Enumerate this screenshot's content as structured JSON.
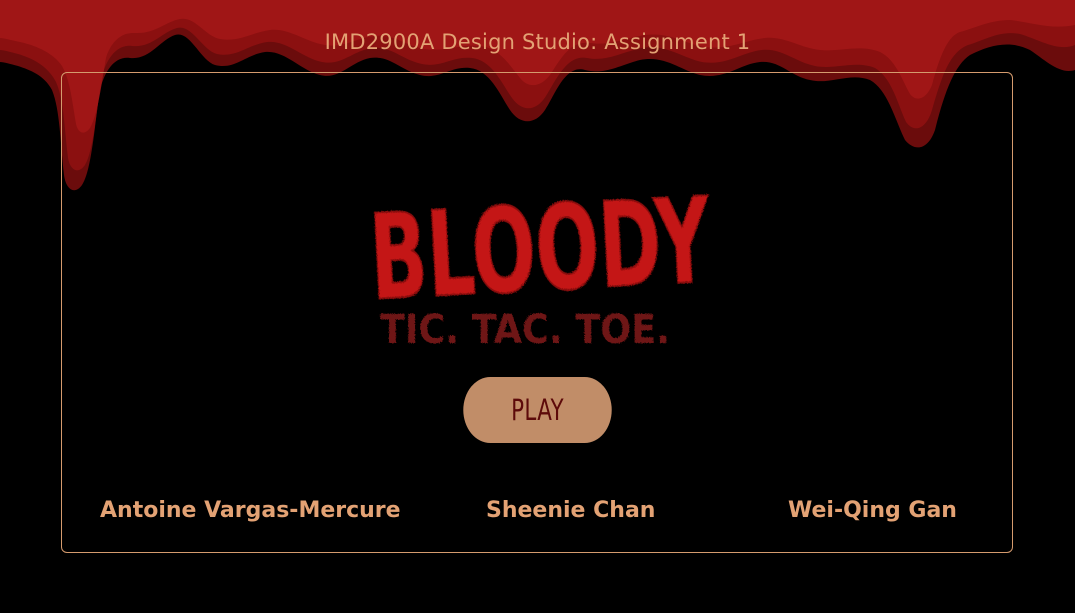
{
  "header": {
    "title": "IMD2900A Design Studio: Assignment 1"
  },
  "logo": {
    "main_text": "BLOODY",
    "sub_text": "TIC. TAC. TOE."
  },
  "play_button": {
    "label": "PLAY"
  },
  "credits": [
    "Antoine Vargas-Mercure",
    "Sheenie Chan",
    "Wei-Qing Gan"
  ],
  "colors": {
    "background": "#000000",
    "blood": "#8b1010",
    "accent": "#e3a274",
    "frame_border": "#d59b6e",
    "button_bg": "#c18d68",
    "button_text": "#5d0a0a",
    "logo_main": "#c41414",
    "logo_sub": "#6e1414"
  }
}
